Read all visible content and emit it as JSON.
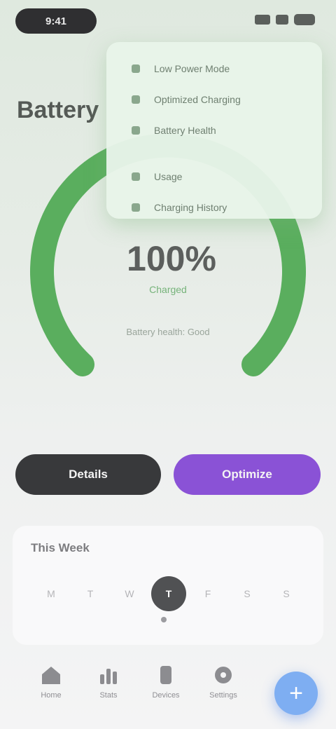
{
  "status_bar": {
    "time": "9:41"
  },
  "page_title": "Battery",
  "gauge": {
    "value_text": "100%",
    "sub_text": "Charged",
    "caption": "Battery health: Good",
    "level": 1.0,
    "color": "#5aae5e"
  },
  "dropdown": {
    "items": [
      {
        "label": "Low Power Mode"
      },
      {
        "label": "Optimized Charging"
      },
      {
        "label": "Battery Health"
      },
      {
        "label": "Usage"
      },
      {
        "label": "Charging History"
      }
    ]
  },
  "buttons": {
    "primary": "Details",
    "secondary": "Optimize"
  },
  "week": {
    "title": "This Week",
    "days": [
      {
        "label": "M"
      },
      {
        "label": "T"
      },
      {
        "label": "W"
      },
      {
        "label": "T"
      },
      {
        "label": "F"
      },
      {
        "label": "S"
      },
      {
        "label": "S"
      }
    ],
    "active_index": 3
  },
  "tabbar": {
    "tabs": [
      {
        "label": "Home",
        "icon": "home-icon"
      },
      {
        "label": "Stats",
        "icon": "stats-icon"
      },
      {
        "label": "Devices",
        "icon": "devices-icon"
      },
      {
        "label": "Settings",
        "icon": "gear-icon"
      }
    ],
    "fab_label": "+"
  },
  "colors": {
    "accent_purple": "#8a52d6",
    "fab_blue": "#7eaef2"
  }
}
